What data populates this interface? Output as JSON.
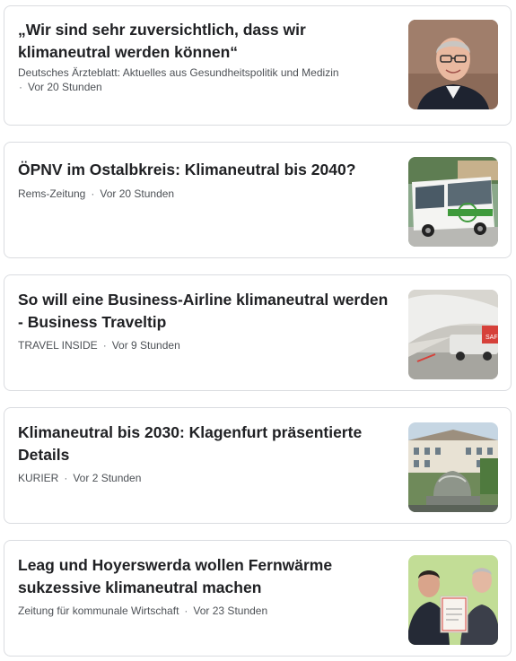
{
  "articles": [
    {
      "title": "„Wir sind sehr zuversichtlich, dass wir klimaneutral werden können“",
      "source": "Deutsches Ärzteblatt: Aktuelles aus Gesundheitspolitik und Medizin",
      "separator": "·",
      "time": "Vor 20 Stunden",
      "thumbnail": "portrait-photo"
    },
    {
      "title": "ÖPNV im Ostalbkreis: Klimaneutral bis 2040?",
      "source": "Rems-Zeitung",
      "separator": "·",
      "time": "Vor 20 Stunden",
      "thumbnail": "bus-photo"
    },
    {
      "title": "So will eine Business-Airline klimaneutral werden - Business Traveltip",
      "source": "TRAVEL INSIDE",
      "separator": "·",
      "time": "Vor 9 Stunden",
      "thumbnail": "aircraft-refuel-photo"
    },
    {
      "title": "Klimaneutral bis 2030: Klagenfurt präsentierte Details",
      "source": "KURIER",
      "separator": "·",
      "time": "Vor 2 Stunden",
      "thumbnail": "city-fountain-photo"
    },
    {
      "title": "Leag und Hoyerswerda wollen Fernwärme sukzessive klimaneutral machen",
      "source": "Zeitung für kommunale Wirtschaft",
      "separator": "·",
      "time": "Vor 23 Stunden",
      "thumbnail": "handshake-photo"
    }
  ],
  "colors": {
    "headline": "#202124",
    "meta": "#4d5156",
    "border": "#dadce0"
  }
}
